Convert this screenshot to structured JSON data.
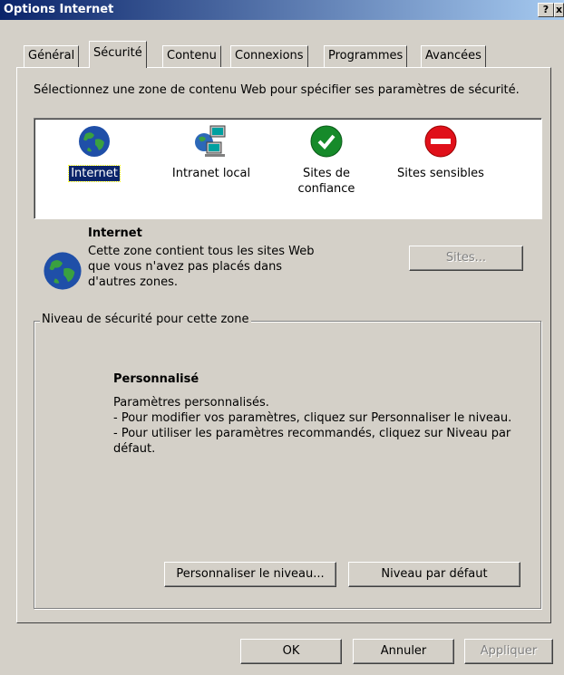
{
  "window": {
    "title": "Options Internet",
    "help_label": "?",
    "close_label": "x"
  },
  "tabs": [
    {
      "label": "Général"
    },
    {
      "label": "Sécurité"
    },
    {
      "label": "Contenu"
    },
    {
      "label": "Connexions"
    },
    {
      "label": "Programmes"
    },
    {
      "label": "Avancées"
    }
  ],
  "security": {
    "instruction": "Sélectionnez une zone de contenu Web pour spécifier ses paramètres de sécurité.",
    "zones": [
      {
        "label": "Internet",
        "icon": "globe-icon",
        "selected": true
      },
      {
        "label": "Intranet local",
        "icon": "network-computers-icon",
        "selected": false
      },
      {
        "label": "Sites de confiance",
        "icon": "trusted-check-icon",
        "selected": false
      },
      {
        "label": "Sites sensibles",
        "icon": "restricted-no-entry-icon",
        "selected": false
      }
    ],
    "zone_detail": {
      "title": "Internet",
      "description": "Cette zone contient tous les sites Web que vous n'avez pas placés dans d'autres zones.",
      "sites_button": "Sites..."
    },
    "level_group": {
      "title": "Niveau de sécurité pour cette zone",
      "level_name": "Personnalisé",
      "line1": "Paramètres personnalisés.",
      "line2": "- Pour modifier vos paramètres, cliquez sur Personnaliser le niveau.",
      "line3": "- Pour utiliser les paramètres recommandés, cliquez sur Niveau par défaut.",
      "custom_button": "Personnaliser le niveau...",
      "default_button": "Niveau par défaut"
    }
  },
  "footer": {
    "ok": "OK",
    "cancel": "Annuler",
    "apply": "Appliquer"
  },
  "colors": {
    "title_start": "#0a246a",
    "title_end": "#a6caf0",
    "face": "#d4d0c8",
    "selection": "#0a246a"
  }
}
